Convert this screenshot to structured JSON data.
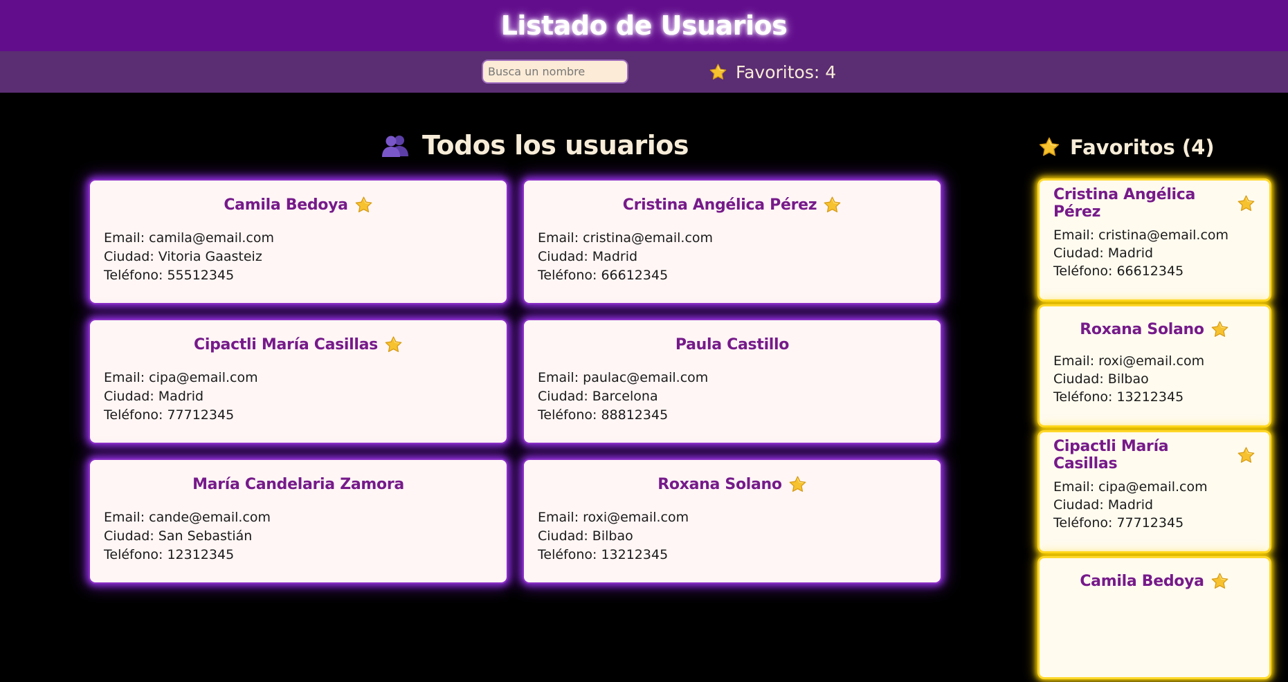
{
  "header": {
    "title": "Listado de Usuarios"
  },
  "toolbar": {
    "search_placeholder": "Busca un nombre",
    "favorites_counter": "Favoritos: 4",
    "star_icon": "star-icon"
  },
  "main": {
    "title": "Todos los usuarios",
    "title_icon": "people-icon",
    "users": [
      {
        "name": "Camila Bedoya",
        "favorite": true,
        "email": "Email: camila@email.com",
        "city": "Ciudad: Vitoria Gaasteiz",
        "phone": "Teléfono: 55512345"
      },
      {
        "name": "Cristina Angélica Pérez",
        "favorite": true,
        "email": "Email: cristina@email.com",
        "city": "Ciudad: Madrid",
        "phone": "Teléfono: 66612345"
      },
      {
        "name": "Cipactli María Casillas",
        "favorite": true,
        "email": "Email: cipa@email.com",
        "city": "Ciudad: Madrid",
        "phone": "Teléfono: 77712345"
      },
      {
        "name": "Paula Castillo",
        "favorite": false,
        "email": "Email: paulac@email.com",
        "city": "Ciudad: Barcelona",
        "phone": "Teléfono: 88812345"
      },
      {
        "name": "María Candelaria Zamora",
        "favorite": false,
        "email": "Email: cande@email.com",
        "city": "Ciudad: San Sebastián",
        "phone": "Teléfono: 12312345"
      },
      {
        "name": "Roxana Solano",
        "favorite": true,
        "email": "Email: roxi@email.com",
        "city": "Ciudad: Bilbao",
        "phone": "Teléfono: 13212345"
      }
    ]
  },
  "sidebar": {
    "title": "Favoritos (4)",
    "favorites": [
      {
        "name": "Cristina Angélica Pérez",
        "email": "Email: cristina@email.com",
        "city": "Ciudad: Madrid",
        "phone": "Teléfono: 66612345"
      },
      {
        "name": "Roxana Solano",
        "email": "Email: roxi@email.com",
        "city": "Ciudad: Bilbao",
        "phone": "Teléfono: 13212345"
      },
      {
        "name": "Cipactli María Casillas",
        "email": "Email: cipa@email.com",
        "city": "Ciudad: Madrid",
        "phone": "Teléfono: 77712345"
      },
      {
        "name": "Camila Bedoya",
        "email": "",
        "city": "",
        "phone": ""
      }
    ]
  },
  "colors": {
    "header_bg": "#620d8c",
    "toolbar_bg": "#5b2d72",
    "accent_purple": "#761a8a",
    "card_glow": "#8a2fd6",
    "favorite_glow": "#ffd400"
  }
}
